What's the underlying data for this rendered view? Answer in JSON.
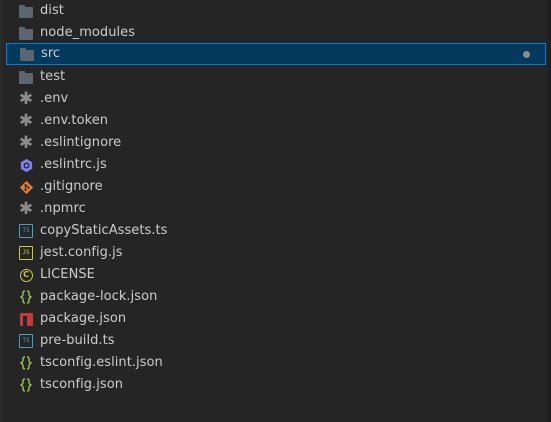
{
  "explorer": {
    "colors": {
      "text": "#cccccc",
      "folder": "#5d6670",
      "selection_bg": "#04395e",
      "selection_border": "#007fd4",
      "modified_dot": "#8c8c8c"
    },
    "items": [
      {
        "label": "dist",
        "icon": "folder-icon",
        "kind": "folder"
      },
      {
        "label": "node_modules",
        "icon": "folder-icon",
        "kind": "folder"
      },
      {
        "label": "src",
        "icon": "folder-icon",
        "kind": "folder",
        "selected": true,
        "modified": true
      },
      {
        "label": "test",
        "icon": "folder-icon",
        "kind": "folder"
      },
      {
        "label": ".env",
        "icon": "asterisk-icon",
        "kind": "file"
      },
      {
        "label": ".env.token",
        "icon": "asterisk-icon",
        "kind": "file"
      },
      {
        "label": ".eslintignore",
        "icon": "asterisk-icon",
        "kind": "file"
      },
      {
        "label": ".eslintrc.js",
        "icon": "eslint-icon",
        "kind": "file"
      },
      {
        "label": ".gitignore",
        "icon": "git-icon",
        "kind": "file"
      },
      {
        "label": ".npmrc",
        "icon": "asterisk-icon",
        "kind": "file"
      },
      {
        "label": "copyStaticAssets.ts",
        "icon": "typescript-icon",
        "kind": "file",
        "badge": "TS"
      },
      {
        "label": "jest.config.js",
        "icon": "javascript-icon",
        "kind": "file",
        "badge": "JS"
      },
      {
        "label": "LICENSE",
        "icon": "license-icon",
        "kind": "file",
        "badge": "C"
      },
      {
        "label": "package-lock.json",
        "icon": "json-icon",
        "kind": "file"
      },
      {
        "label": "package.json",
        "icon": "npm-icon",
        "kind": "file"
      },
      {
        "label": "pre-build.ts",
        "icon": "typescript-icon",
        "kind": "file",
        "badge": "TS"
      },
      {
        "label": "tsconfig.eslint.json",
        "icon": "json-icon",
        "kind": "file"
      },
      {
        "label": "tsconfig.json",
        "icon": "json-icon",
        "kind": "file"
      }
    ]
  }
}
